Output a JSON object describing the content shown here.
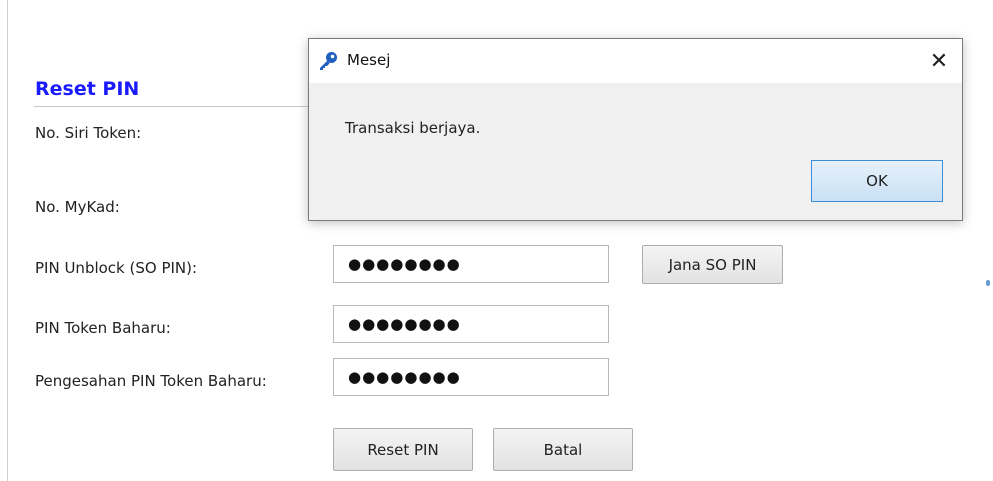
{
  "form": {
    "title": "Reset PIN",
    "labels": {
      "serial": "No. Siri Token:",
      "mykad": "No. MyKad:",
      "unblock": "PIN Unblock (SO PIN):",
      "new_pin": "PIN Token Baharu:",
      "confirm_pin": "Pengesahan PIN Token Baharu:"
    },
    "values": {
      "unblock": "●●●●●●●●",
      "new_pin": "●●●●●●●●",
      "confirm_pin": "●●●●●●●●"
    },
    "buttons": {
      "generate_so_pin": "Jana SO PIN",
      "reset": "Reset PIN",
      "cancel": "Batal"
    }
  },
  "dialog": {
    "title": "Mesej",
    "message": "Transaksi berjaya.",
    "ok_label": "OK",
    "close_symbol": "✕"
  },
  "colors": {
    "title_blue": "#1a1aff",
    "ok_border": "#3c8fd6"
  }
}
